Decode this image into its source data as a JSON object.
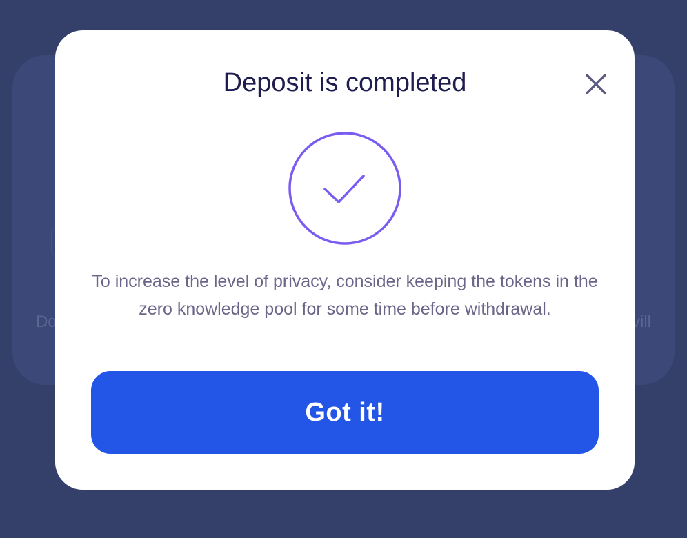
{
  "background": {
    "left_fragment": "Do",
    "right_fragment": "vill"
  },
  "modal": {
    "title": "Deposit is completed",
    "close_icon": "close-icon",
    "status_icon": "checkmark-circle-icon",
    "message": "To increase the level of privacy, consider keeping the tokens in the zero knowledge pool for some time before withdrawal.",
    "button_label": "Got it!"
  },
  "colors": {
    "backdrop": "#35406a",
    "modal_bg": "#ffffff",
    "title": "#1f1c4f",
    "accent_purple": "#7b5cf0",
    "primary_button": "#2355e6",
    "message_text": "#6b6689"
  }
}
